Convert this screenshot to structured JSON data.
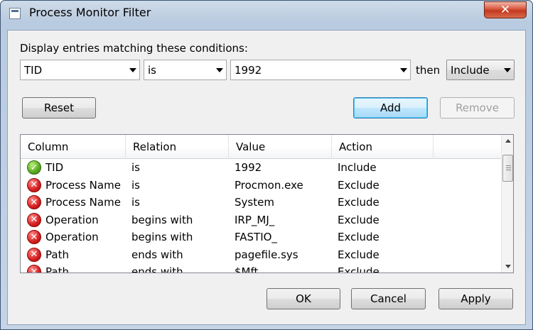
{
  "window": {
    "title": "Process Monitor Filter",
    "close_glyph": "✕"
  },
  "filter": {
    "label": "Display entries matching these conditions:",
    "column_value": "TID",
    "relation_value": "is",
    "value_value": "1992",
    "then_label": "then",
    "action_value": "Include"
  },
  "buttons": {
    "reset": "Reset",
    "add": "Add",
    "remove": "Remove",
    "ok": "OK",
    "cancel": "Cancel",
    "apply": "Apply"
  },
  "list": {
    "headers": [
      "Column",
      "Relation",
      "Value",
      "Action"
    ],
    "rows": [
      {
        "status": "include",
        "column": "TID",
        "relation": "is",
        "value": "1992",
        "action": "Include"
      },
      {
        "status": "exclude",
        "column": "Process Name",
        "relation": "is",
        "value": "Procmon.exe",
        "action": "Exclude"
      },
      {
        "status": "exclude",
        "column": "Process Name",
        "relation": "is",
        "value": "System",
        "action": "Exclude"
      },
      {
        "status": "exclude",
        "column": "Operation",
        "relation": "begins with",
        "value": "IRP_MJ_",
        "action": "Exclude"
      },
      {
        "status": "exclude",
        "column": "Operation",
        "relation": "begins with",
        "value": "FASTIO_",
        "action": "Exclude"
      },
      {
        "status": "exclude",
        "column": "Path",
        "relation": "ends with",
        "value": "pagefile.sys",
        "action": "Exclude"
      },
      {
        "status": "exclude",
        "column": "Path",
        "relation": "ends with",
        "value": "$Mft",
        "action": "Exclude"
      }
    ]
  },
  "icons": {
    "include": "check-circle-icon",
    "exclude": "x-circle-icon"
  },
  "colors": {
    "include_green": "#5aa81e",
    "exclude_red": "#d41d1d",
    "default_button_blue": "#3c7fb1"
  }
}
